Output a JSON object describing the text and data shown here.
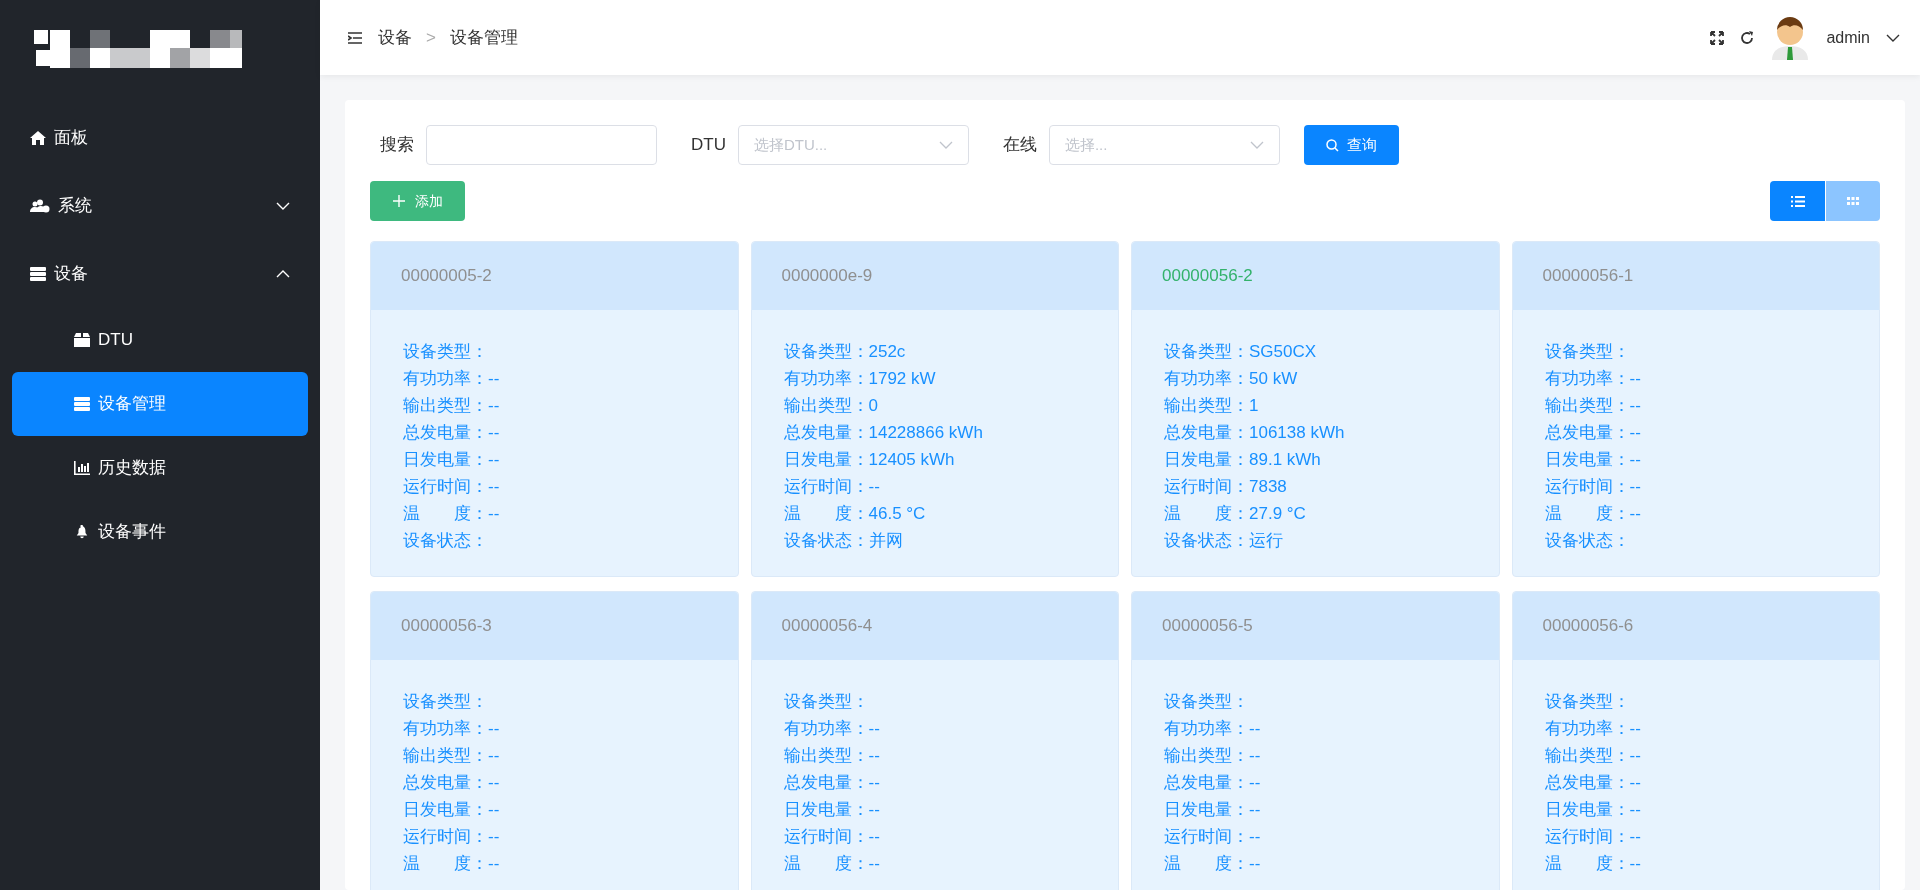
{
  "sidebar": {
    "items": [
      {
        "label": "面板",
        "selected": false
      },
      {
        "label": "系统",
        "selected": false,
        "expanded": false
      },
      {
        "label": "设备",
        "selected": false,
        "expanded": true,
        "children": [
          {
            "label": "DTU",
            "selected": false
          },
          {
            "label": "设备管理",
            "selected": true
          },
          {
            "label": "历史数据",
            "selected": false
          },
          {
            "label": "设备事件",
            "selected": false
          }
        ]
      }
    ]
  },
  "header": {
    "breadcrumb": [
      "设备",
      "设备管理"
    ],
    "separator": ">",
    "user": "admin"
  },
  "filters": {
    "search": {
      "label": "搜索"
    },
    "dtu": {
      "label": "DTU",
      "placeholder": "选择DTU..."
    },
    "online": {
      "label": "在线",
      "placeholder": "选择..."
    },
    "query_button": "查询"
  },
  "add_button": "添加",
  "view_toggle": [
    {
      "kind": "list",
      "selected": true
    },
    {
      "kind": "grid",
      "selected": false
    }
  ],
  "devices": [
    {
      "name": "00000005-2",
      "online": false,
      "lines": [
        "设备类型：",
        "有功功率：--",
        "输出类型：--",
        "总发电量：--",
        "日发电量：--",
        "运行时间：--",
        "温　　度：--",
        "设备状态："
      ]
    },
    {
      "name": "0000000e-9",
      "online": false,
      "lines": [
        "设备类型：252c",
        "有功功率：1792 kW",
        "输出类型：0",
        "总发电量：14228866 kWh",
        "日发电量：12405 kWh",
        "运行时间：--",
        "温　　度：46.5 °C",
        "设备状态：并网"
      ]
    },
    {
      "name": "00000056-2",
      "online": true,
      "lines": [
        "设备类型：SG50CX",
        "有功功率：50 kW",
        "输出类型：1",
        "总发电量：106138 kWh",
        "日发电量：89.1 kWh",
        "运行时间：7838",
        "温　　度：27.9 °C",
        "设备状态：运行"
      ]
    },
    {
      "name": "00000056-1",
      "online": false,
      "lines": [
        "设备类型：",
        "有功功率：--",
        "输出类型：--",
        "总发电量：--",
        "日发电量：--",
        "运行时间：--",
        "温　　度：--",
        "设备状态："
      ]
    },
    {
      "name": "00000056-3",
      "online": false,
      "lines": [
        "设备类型：",
        "有功功率：--",
        "输出类型：--",
        "总发电量：--",
        "日发电量：--",
        "运行时间：--",
        "温　　度：--"
      ]
    },
    {
      "name": "00000056-4",
      "online": false,
      "lines": [
        "设备类型：",
        "有功功率：--",
        "输出类型：--",
        "总发电量：--",
        "日发电量：--",
        "运行时间：--",
        "温　　度：--"
      ]
    },
    {
      "name": "00000056-5",
      "online": false,
      "lines": [
        "设备类型：",
        "有功功率：--",
        "输出类型：--",
        "总发电量：--",
        "日发电量：--",
        "运行时间：--",
        "温　　度：--"
      ]
    },
    {
      "name": "00000056-6",
      "online": false,
      "lines": [
        "设备类型：",
        "有功功率：--",
        "输出类型：--",
        "总发电量：--",
        "日发电量：--",
        "运行时间：--",
        "温　　度：--"
      ]
    }
  ]
}
